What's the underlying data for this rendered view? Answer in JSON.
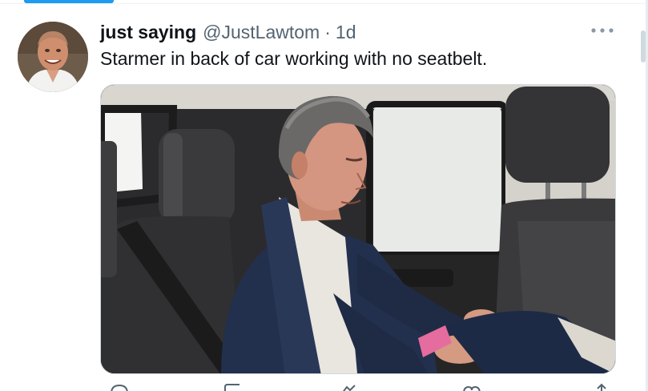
{
  "tweet": {
    "display_name": "just saying",
    "handle": "@JustLawtom",
    "separator": "·",
    "time": "1d",
    "text": "Starmer in back of car working with no seatbelt."
  },
  "icons": {
    "more": "more-horizontal-icon",
    "reply": "reply-icon",
    "retweet": "retweet-icon",
    "like": "like-icon",
    "share": "share-icon"
  },
  "colors": {
    "accent": "#1d9bf0",
    "text_primary": "#0f1419",
    "text_secondary": "#536471"
  }
}
